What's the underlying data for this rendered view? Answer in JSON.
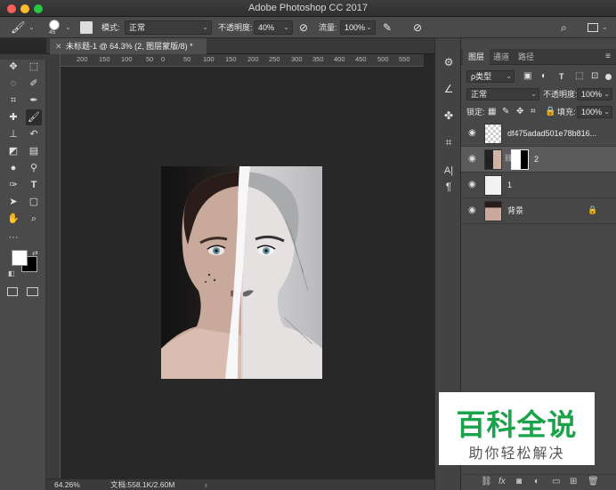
{
  "window": {
    "title": "Adobe Photoshop CC 2017"
  },
  "options": {
    "brush_size": "45",
    "mode_label": "模式:",
    "mode_value": "正常",
    "opacity_label": "不透明度:",
    "opacity_value": "40%",
    "flow_label": "流量:",
    "flow_value": "100%"
  },
  "document": {
    "tab_title": "未标题-1 @ 64.3% (2, 图层蒙版/8) *",
    "ruler_ticks": [
      "200",
      "150",
      "100",
      "50",
      "0",
      "50",
      "100",
      "150",
      "200",
      "250",
      "300",
      "350",
      "400",
      "450",
      "500",
      "550"
    ]
  },
  "status": {
    "zoom": "64.26%",
    "doc_info": "文档:558.1K/2.60M"
  },
  "panel": {
    "tabs": [
      "图层",
      "通道",
      "路径"
    ],
    "filter_label": "ρ类型",
    "blend_mode": "正常",
    "opacity_label": "不透明度:",
    "opacity_value": "100%",
    "lock_label": "锁定:",
    "fill_label": "填充:",
    "fill_value": "100%",
    "layers": [
      {
        "name": "df475adad501e78b816..."
      },
      {
        "name": "2"
      },
      {
        "name": "1"
      },
      {
        "name": "背景"
      }
    ]
  },
  "watermark": {
    "title": "百科全说",
    "subtitle": "助你轻松解决"
  },
  "colors": {
    "accent_green": "#1aa34a",
    "panel_bg": "#474747",
    "canvas_bg": "#282828"
  }
}
